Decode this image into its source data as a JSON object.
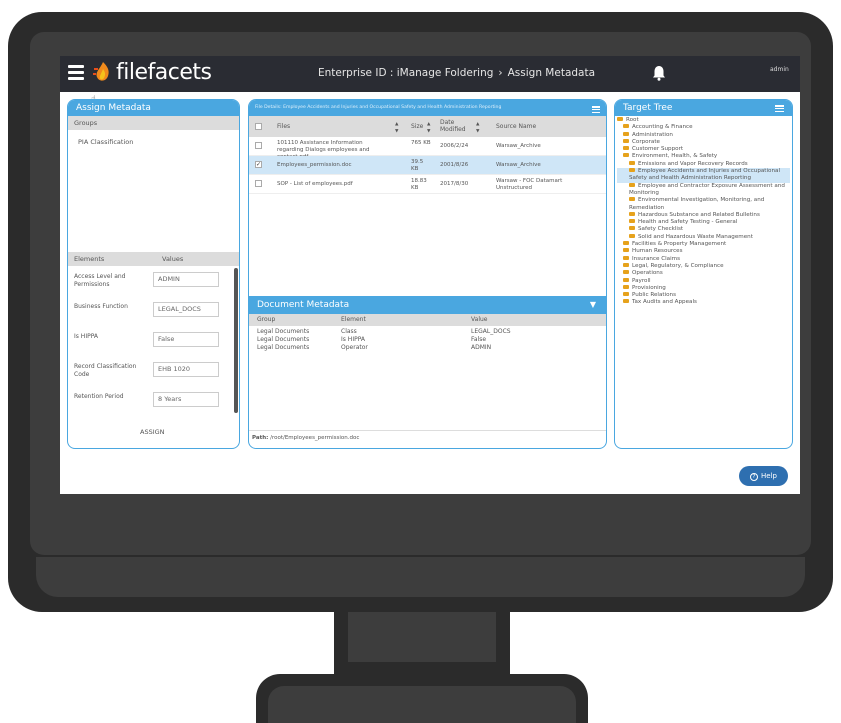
{
  "app": {
    "logo_text": "filefacets",
    "nav_title": "Enterprise ID : iManage Foldering",
    "nav_separator": "›",
    "nav_current": "Assign Metadata",
    "user": "admin"
  },
  "left_panel": {
    "title": "Assign Metadata",
    "groups_header": "Groups",
    "groups": [
      "PIA Classification"
    ],
    "elements_header": "Elements",
    "values_header": "Values",
    "elements": [
      {
        "label": "Access Level and Permissions",
        "value": "ADMIN"
      },
      {
        "label": "Business Function",
        "value": "LEGAL_DOCS"
      },
      {
        "label": "Is HIPPA",
        "value": "False"
      },
      {
        "label": "Record Classification Code",
        "value": "EHB 1020"
      },
      {
        "label": "Retention Period",
        "value": "8 Years"
      }
    ],
    "assign_label": "ASSIGN"
  },
  "middle_panel": {
    "path_header": "File Details: Employee Accidents and Injuries and Occupational Safety and Health Administration Reporting",
    "columns": {
      "files": "Files",
      "size": "Size",
      "date_modified": "Date Modified",
      "source_name": "Source Name"
    },
    "files": [
      {
        "name": "101110 Assistance Information regarding Dialogs employees and contact.pdf",
        "size": "765 KB",
        "date": "2006/2/24",
        "source": "Warsaw_Archive",
        "checked": false
      },
      {
        "name": "Employees_permission.doc",
        "size": "39.5 KB",
        "date": "2001/8/26",
        "source": "Warsaw_Archive",
        "checked": true
      },
      {
        "name": "SOP - List of employees.pdf",
        "size": "18.83 KB",
        "date": "2017/8/30",
        "source": "Warsaw - FOC Datamart Unstructured",
        "checked": false
      }
    ],
    "doc_meta_title": "Document Metadata",
    "doc_meta_columns": {
      "group": "Group",
      "element": "Element",
      "value": "Value"
    },
    "doc_meta_rows": [
      {
        "group": "Legal Documents",
        "element": "Class",
        "value": "LEGAL_DOCS"
      },
      {
        "group": "Legal Documents",
        "element": "Is HIPPA",
        "value": "False"
      },
      {
        "group": "Legal Documents",
        "element": "Operator",
        "value": "ADMIN"
      }
    ],
    "path_label": "Path:",
    "path_value": "/root/Employees_permission.doc"
  },
  "right_panel": {
    "title": "Target Tree",
    "tree": [
      {
        "label": "Root",
        "level": 0
      },
      {
        "label": "Accounting & Finance",
        "level": 1
      },
      {
        "label": "Administration",
        "level": 1
      },
      {
        "label": "Corporate",
        "level": 1
      },
      {
        "label": "Customer Support",
        "level": 1
      },
      {
        "label": "Environment, Health, & Safety",
        "level": 1
      },
      {
        "label": "Emissions and Vapor Recovery Records",
        "level": 2
      },
      {
        "label": "Employee Accidents and Injuries and Occupational Safety and Health Administration Reporting",
        "level": 2,
        "selected": true
      },
      {
        "label": "Employee and Contractor Exposure Assessment and Monitoring",
        "level": 2
      },
      {
        "label": "Environmental Investigation, Monitoring, and Remediation",
        "level": 2
      },
      {
        "label": "Hazardous Substance and Related Bulletins",
        "level": 2
      },
      {
        "label": "Health and Safety Testing - General",
        "level": 2
      },
      {
        "label": "Safety Checklist",
        "level": 2
      },
      {
        "label": "Solid and Hazardous Waste Management",
        "level": 2
      },
      {
        "label": "Facilities & Property Management",
        "level": 1
      },
      {
        "label": "Human Resources",
        "level": 1
      },
      {
        "label": "Insurance Claims",
        "level": 1
      },
      {
        "label": "Legal, Regulatory, & Compliance",
        "level": 1
      },
      {
        "label": "Operations",
        "level": 1
      },
      {
        "label": "Payroll",
        "level": 1
      },
      {
        "label": "Provisioning",
        "level": 1
      },
      {
        "label": "Public Relations",
        "level": 1
      },
      {
        "label": "Tax Audits and Appeals",
        "level": 1
      }
    ]
  },
  "help_label": "Help",
  "colors": {
    "accent": "#4aa7e0",
    "topbar": "#2a2c33",
    "help": "#2e6fb0",
    "folder": "#e6a21c",
    "selected_row": "#cfe6f7"
  }
}
